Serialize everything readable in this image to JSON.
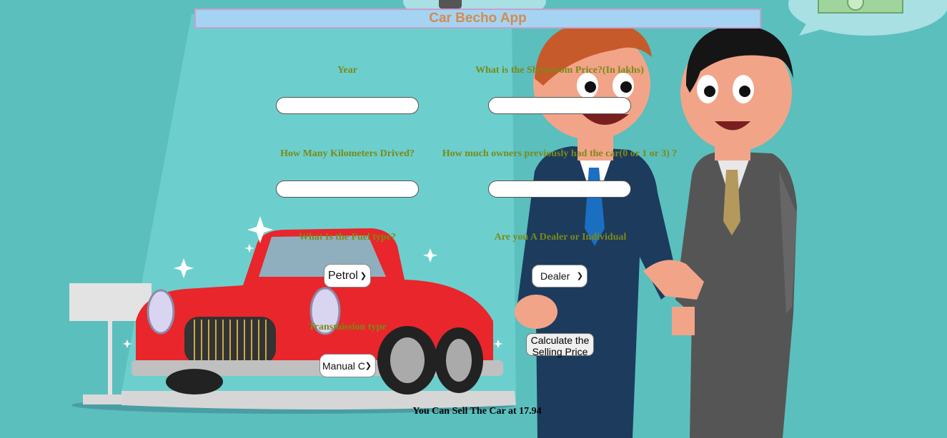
{
  "app": {
    "title": "Car Becho App"
  },
  "form": {
    "year_label": "Year",
    "year_value": "",
    "price_label": "What is the Showroom Price?(In lakhs)",
    "price_value": "",
    "km_label": "How Many Kilometers Drived?",
    "km_value": "",
    "owners_label": "How much owners previously had the car(0 or 1 or 3) ?",
    "owners_value": "",
    "fuel_label": "What Is the Fuel type?",
    "fuel_selected": "Petrol",
    "seller_label": "Are you A Dealer or Individual",
    "seller_selected": "Dealer",
    "transmission_label": "Transmission type",
    "transmission_selected": "Manual C",
    "calculate_button": "Calculate the Selling Price"
  },
  "result": {
    "text": "You Can Sell The Car at 17.94"
  },
  "colors": {
    "background": "#5bbfbd",
    "title_bar": "#a5d4f2",
    "title_text": "#d68a52",
    "label_text": "#7b8a17",
    "car": "#e8262b"
  },
  "icons": [
    "sparkle-icon",
    "money-icon",
    "select-chevron-icon"
  ]
}
